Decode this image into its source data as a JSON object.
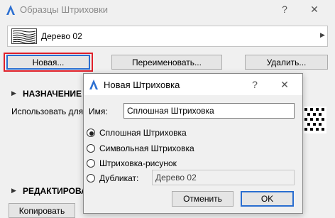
{
  "main_window": {
    "title": "Образцы Штриховки",
    "help_button": "?",
    "close_button": "✕",
    "combo": {
      "selected": "Дерево 02",
      "icon": "wood-hatch-icon"
    },
    "buttons": {
      "new": "Новая...",
      "rename": "Переименовать...",
      "delete": "Удалить..."
    },
    "sections": {
      "assignment": "НАЗНАЧЕНИЕ И",
      "use_for_label": "Использовать для:",
      "editing": "РЕДАКТИРОВА"
    },
    "copy_button": "Копировать"
  },
  "dialog": {
    "title": "Новая Штриховка",
    "help_button": "?",
    "close_button": "✕",
    "name_label": "Имя:",
    "name_value": "Сплошная Штриховка",
    "options": [
      {
        "label": "Сплошная Штриховка",
        "selected": true
      },
      {
        "label": "Символьная Штриховка",
        "selected": false
      },
      {
        "label": "Штриховка-рисунок",
        "selected": false
      },
      {
        "label": "Дубликат:",
        "selected": false
      }
    ],
    "duplicate_value": "Дерево 02",
    "cancel": "Отменить",
    "ok": "OK"
  },
  "colors": {
    "accent": "#2a6ed0",
    "highlight": "#e0202a"
  }
}
